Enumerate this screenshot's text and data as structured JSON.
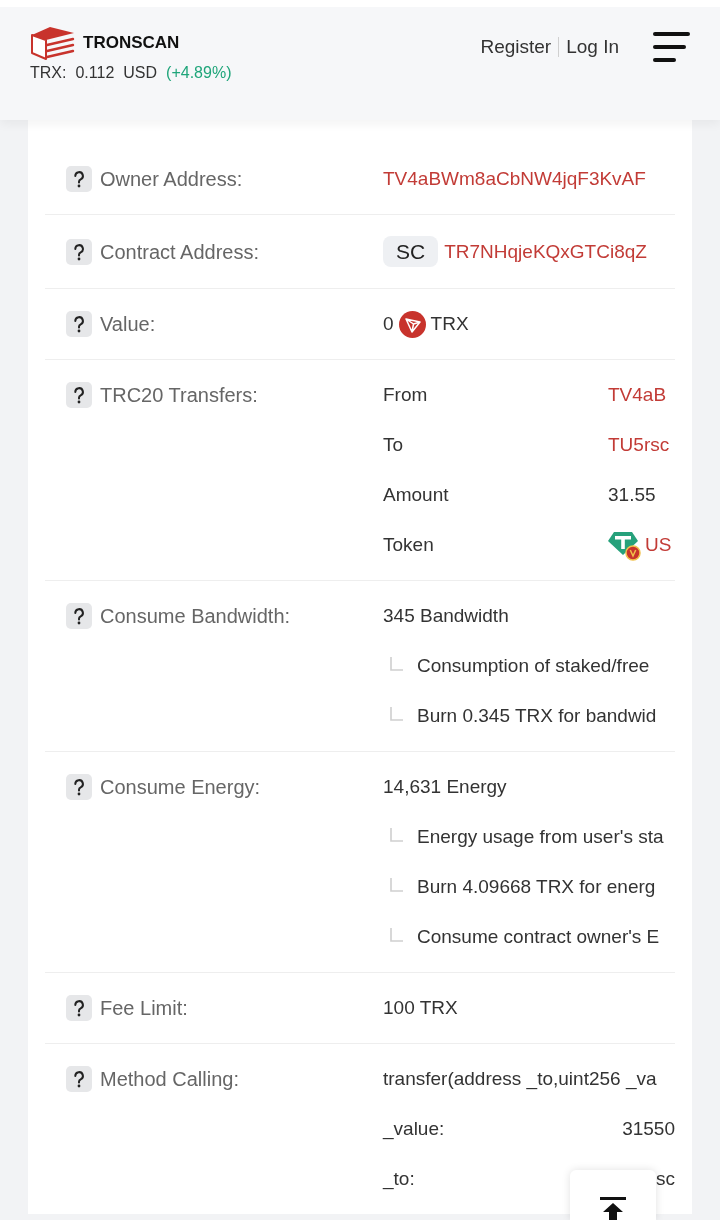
{
  "header": {
    "brand": "TRONSCAN",
    "price": {
      "label": "TRX:",
      "value": "0.112",
      "unit": "USD",
      "change": "(+4.89%)"
    },
    "links": [
      "Register",
      "Log In"
    ]
  },
  "rows": [
    {
      "kind": "address",
      "label": "Owner Address:",
      "value": "TV4aBWm8aCbNW4jqF3KvAF"
    },
    {
      "kind": "contract",
      "label": "Contract Address:",
      "badge": "SC",
      "value": "TR7NHqjeKQxGTCi8qZ"
    },
    {
      "kind": "amount",
      "label": "Value:",
      "amount": "0",
      "unit": "TRX"
    },
    {
      "kind": "pairs",
      "label": "TRC20 Transfers:",
      "pairs": [
        {
          "kind": "link",
          "key": "From",
          "value": "TV4aB"
        },
        {
          "kind": "link",
          "key": "To",
          "value": "TU5rsc"
        },
        {
          "kind": "text",
          "key": "Amount",
          "value": "31.55"
        },
        {
          "kind": "token",
          "key": "Token",
          "value": "US"
        }
      ]
    },
    {
      "kind": "resource",
      "label": "Consume Bandwidth:",
      "total": "345 Bandwidth",
      "details": [
        "Consumption of staked/free",
        "Burn 0.345 TRX for bandwid"
      ]
    },
    {
      "kind": "resource",
      "label": "Consume Energy:",
      "total": "14,631 Energy",
      "details": [
        "Energy usage from user's sta",
        "Burn 4.09668 TRX for energ",
        "Consume contract owner's E"
      ]
    },
    {
      "kind": "text",
      "label": "Fee Limit:",
      "value": "100 TRX"
    },
    {
      "kind": "method",
      "label": "Method Calling:",
      "signature": "transfer(address _to,uint256 _va",
      "params": [
        {
          "name": "_value:",
          "value": "31550"
        },
        {
          "name": "_to:",
          "value": "sc"
        }
      ]
    }
  ]
}
